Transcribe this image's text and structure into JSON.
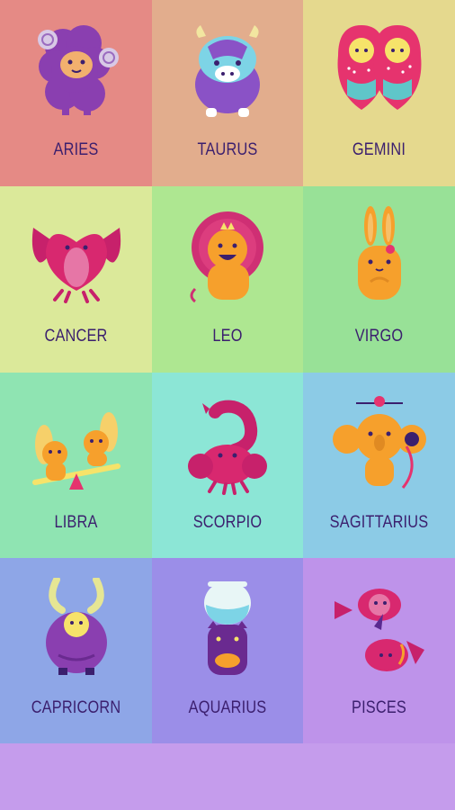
{
  "signs": [
    {
      "label": "ARIES",
      "bg": "#e58a85",
      "icon": "ram-icon"
    },
    {
      "label": "TAURUS",
      "bg": "#e2ad8d",
      "icon": "bull-icon"
    },
    {
      "label": "GEMINI",
      "bg": "#e5d98e",
      "icon": "twins-icon"
    },
    {
      "label": "CANCER",
      "bg": "#dbe99a",
      "icon": "crab-icon"
    },
    {
      "label": "LEO",
      "bg": "#aee791",
      "icon": "lion-icon"
    },
    {
      "label": "VIRGO",
      "bg": "#98e197",
      "icon": "bunny-icon"
    },
    {
      "label": "LIBRA",
      "bg": "#8fe4b2",
      "icon": "squirrels-seesaw-icon"
    },
    {
      "label": "SCORPIO",
      "bg": "#8ce6d6",
      "icon": "scorpion-icon"
    },
    {
      "label": "SAGITTARIUS",
      "bg": "#8ccbe6",
      "icon": "koala-archer-icon"
    },
    {
      "label": "CAPRICORN",
      "bg": "#8ea6e7",
      "icon": "goat-icon"
    },
    {
      "label": "AQUARIUS",
      "bg": "#9b8ee8",
      "icon": "cat-fishbowl-icon"
    },
    {
      "label": "PISCES",
      "bg": "#be93ea",
      "icon": "fish-icon"
    }
  ],
  "background": "#c59cec"
}
